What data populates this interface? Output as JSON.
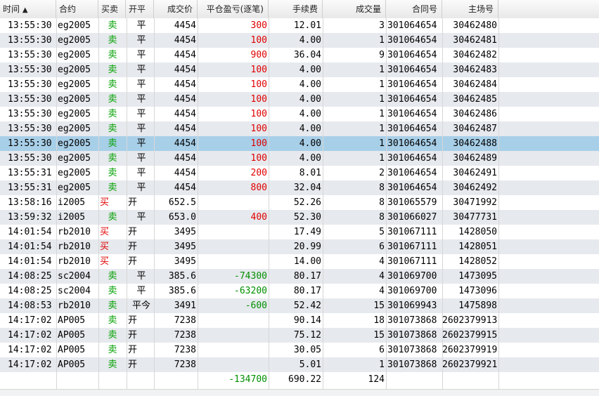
{
  "colors": {
    "buy": "#e00000",
    "sell": "#00a000",
    "profit": "#e00000",
    "loss": "#009000",
    "selected_row": "#a8cfe8",
    "zebra": "#e6e9ed"
  },
  "header": {
    "time": "时间",
    "sort_indicator": "▲",
    "contract": "合约",
    "side": "买卖",
    "offset": "开平",
    "price": "成交价",
    "close_pnl": "平仓盈亏(逐笔)",
    "fee": "手续费",
    "volume": "成交量",
    "contract_no": "合同号",
    "exch_no": "主场号"
  },
  "rows": [
    {
      "time": "13:55:30",
      "contract": "eg2005",
      "side": "卖",
      "side_type": "sell",
      "offset": "平",
      "price": "4454",
      "pnl": "300",
      "pnl_type": "profit",
      "fee": "12.01",
      "vol": "3",
      "contract_no": "301064654",
      "exch_no": "30462480"
    },
    {
      "time": "13:55:30",
      "contract": "eg2005",
      "side": "卖",
      "side_type": "sell",
      "offset": "平",
      "price": "4454",
      "pnl": "100",
      "pnl_type": "profit",
      "fee": "4.00",
      "vol": "1",
      "contract_no": "301064654",
      "exch_no": "30462481"
    },
    {
      "time": "13:55:30",
      "contract": "eg2005",
      "side": "卖",
      "side_type": "sell",
      "offset": "平",
      "price": "4454",
      "pnl": "900",
      "pnl_type": "profit",
      "fee": "36.04",
      "vol": "9",
      "contract_no": "301064654",
      "exch_no": "30462482"
    },
    {
      "time": "13:55:30",
      "contract": "eg2005",
      "side": "卖",
      "side_type": "sell",
      "offset": "平",
      "price": "4454",
      "pnl": "100",
      "pnl_type": "profit",
      "fee": "4.00",
      "vol": "1",
      "contract_no": "301064654",
      "exch_no": "30462483"
    },
    {
      "time": "13:55:30",
      "contract": "eg2005",
      "side": "卖",
      "side_type": "sell",
      "offset": "平",
      "price": "4454",
      "pnl": "100",
      "pnl_type": "profit",
      "fee": "4.00",
      "vol": "1",
      "contract_no": "301064654",
      "exch_no": "30462484"
    },
    {
      "time": "13:55:30",
      "contract": "eg2005",
      "side": "卖",
      "side_type": "sell",
      "offset": "平",
      "price": "4454",
      "pnl": "100",
      "pnl_type": "profit",
      "fee": "4.00",
      "vol": "1",
      "contract_no": "301064654",
      "exch_no": "30462485"
    },
    {
      "time": "13:55:30",
      "contract": "eg2005",
      "side": "卖",
      "side_type": "sell",
      "offset": "平",
      "price": "4454",
      "pnl": "100",
      "pnl_type": "profit",
      "fee": "4.00",
      "vol": "1",
      "contract_no": "301064654",
      "exch_no": "30462486"
    },
    {
      "time": "13:55:30",
      "contract": "eg2005",
      "side": "卖",
      "side_type": "sell",
      "offset": "平",
      "price": "4454",
      "pnl": "100",
      "pnl_type": "profit",
      "fee": "4.00",
      "vol": "1",
      "contract_no": "301064654",
      "exch_no": "30462487"
    },
    {
      "time": "13:55:30",
      "contract": "eg2005",
      "side": "卖",
      "side_type": "sell",
      "offset": "平",
      "price": "4454",
      "pnl": "100",
      "pnl_type": "profit",
      "fee": "4.00",
      "vol": "1",
      "contract_no": "301064654",
      "exch_no": "30462488",
      "selected": true
    },
    {
      "time": "13:55:30",
      "contract": "eg2005",
      "side": "卖",
      "side_type": "sell",
      "offset": "平",
      "price": "4454",
      "pnl": "100",
      "pnl_type": "profit",
      "fee": "4.00",
      "vol": "1",
      "contract_no": "301064654",
      "exch_no": "30462489"
    },
    {
      "time": "13:55:31",
      "contract": "eg2005",
      "side": "卖",
      "side_type": "sell",
      "offset": "平",
      "price": "4454",
      "pnl": "200",
      "pnl_type": "profit",
      "fee": "8.01",
      "vol": "2",
      "contract_no": "301064654",
      "exch_no": "30462491"
    },
    {
      "time": "13:55:31",
      "contract": "eg2005",
      "side": "卖",
      "side_type": "sell",
      "offset": "平",
      "price": "4454",
      "pnl": "800",
      "pnl_type": "profit",
      "fee": "32.04",
      "vol": "8",
      "contract_no": "301064654",
      "exch_no": "30462492"
    },
    {
      "time": "13:58:16",
      "contract": "i2005",
      "side": "买",
      "side_type": "buy",
      "offset": "开",
      "price": "652.5",
      "pnl": "",
      "pnl_type": "none",
      "fee": "52.26",
      "vol": "8",
      "contract_no": "301065579",
      "exch_no": "30471992"
    },
    {
      "time": "13:59:32",
      "contract": "i2005",
      "side": "卖",
      "side_type": "sell",
      "offset": "平",
      "price": "653.0",
      "pnl": "400",
      "pnl_type": "profit",
      "fee": "52.30",
      "vol": "8",
      "contract_no": "301066027",
      "exch_no": "30477731"
    },
    {
      "time": "14:01:54",
      "contract": "rb2010",
      "side": "买",
      "side_type": "buy",
      "offset": "开",
      "price": "3495",
      "pnl": "",
      "pnl_type": "none",
      "fee": "17.49",
      "vol": "5",
      "contract_no": "301067111",
      "exch_no": "1428050"
    },
    {
      "time": "14:01:54",
      "contract": "rb2010",
      "side": "买",
      "side_type": "buy",
      "offset": "开",
      "price": "3495",
      "pnl": "",
      "pnl_type": "none",
      "fee": "20.99",
      "vol": "6",
      "contract_no": "301067111",
      "exch_no": "1428051"
    },
    {
      "time": "14:01:54",
      "contract": "rb2010",
      "side": "买",
      "side_type": "buy",
      "offset": "开",
      "price": "3495",
      "pnl": "",
      "pnl_type": "none",
      "fee": "14.00",
      "vol": "4",
      "contract_no": "301067111",
      "exch_no": "1428052"
    },
    {
      "time": "14:08:25",
      "contract": "sc2004",
      "side": "卖",
      "side_type": "sell",
      "offset": "平",
      "price": "385.6",
      "pnl": "-74300",
      "pnl_type": "loss",
      "fee": "80.17",
      "vol": "4",
      "contract_no": "301069700",
      "exch_no": "1473095"
    },
    {
      "time": "14:08:25",
      "contract": "sc2004",
      "side": "卖",
      "side_type": "sell",
      "offset": "平",
      "price": "385.6",
      "pnl": "-63200",
      "pnl_type": "loss",
      "fee": "80.17",
      "vol": "4",
      "contract_no": "301069700",
      "exch_no": "1473096"
    },
    {
      "time": "14:08:53",
      "contract": "rb2010",
      "side": "卖",
      "side_type": "sell",
      "offset": "平今",
      "price": "3491",
      "pnl": "-600",
      "pnl_type": "loss",
      "fee": "52.42",
      "vol": "15",
      "contract_no": "301069943",
      "exch_no": "1475898"
    },
    {
      "time": "14:17:02",
      "contract": "AP005",
      "side": "卖",
      "side_type": "sell",
      "offset": "开",
      "price": "7238",
      "pnl": "",
      "pnl_type": "none",
      "fee": "90.14",
      "vol": "18",
      "contract_no": "301073868",
      "exch_no": "2602379913"
    },
    {
      "time": "14:17:02",
      "contract": "AP005",
      "side": "卖",
      "side_type": "sell",
      "offset": "开",
      "price": "7238",
      "pnl": "",
      "pnl_type": "none",
      "fee": "75.12",
      "vol": "15",
      "contract_no": "301073868",
      "exch_no": "2602379915"
    },
    {
      "time": "14:17:02",
      "contract": "AP005",
      "side": "卖",
      "side_type": "sell",
      "offset": "开",
      "price": "7238",
      "pnl": "",
      "pnl_type": "none",
      "fee": "30.05",
      "vol": "6",
      "contract_no": "301073868",
      "exch_no": "2602379919"
    },
    {
      "time": "14:17:02",
      "contract": "AP005",
      "side": "卖",
      "side_type": "sell",
      "offset": "开",
      "price": "7238",
      "pnl": "",
      "pnl_type": "none",
      "fee": "5.01",
      "vol": "1",
      "contract_no": "301073868",
      "exch_no": "2602379921"
    }
  ],
  "totals": {
    "pnl": "-134700",
    "fee": "690.22",
    "vol": "124"
  }
}
